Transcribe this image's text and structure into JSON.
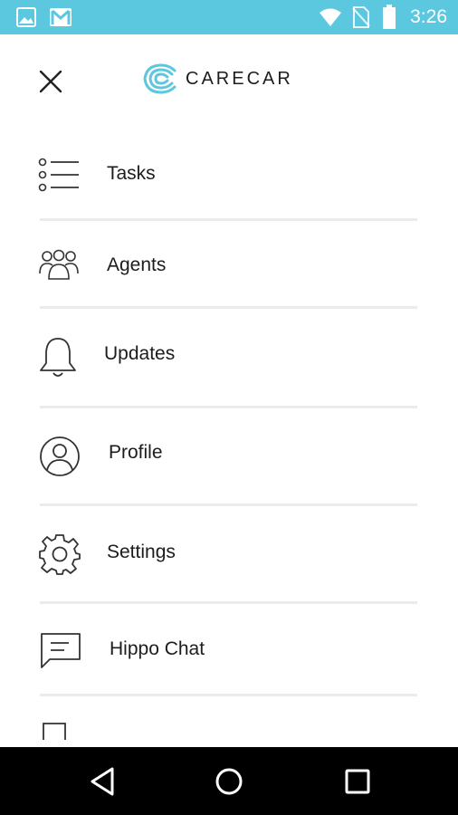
{
  "status_bar": {
    "time": "3:26",
    "icons": [
      "image-icon",
      "gmail-icon",
      "wifi-icon",
      "no-sim-icon",
      "battery-icon"
    ],
    "background": "#5cc8e0"
  },
  "header": {
    "close_icon": "close-icon",
    "logo_text": "CARECAR",
    "logo_color": "#5cc8e0"
  },
  "menu": {
    "items": [
      {
        "label": "Tasks",
        "icon": "list-icon"
      },
      {
        "label": "Agents",
        "icon": "agents-icon"
      },
      {
        "label": "Updates",
        "icon": "bell-icon"
      },
      {
        "label": "Profile",
        "icon": "profile-icon"
      },
      {
        "label": "Settings",
        "icon": "gear-icon"
      },
      {
        "label": "Hippo Chat",
        "icon": "chat-icon"
      }
    ]
  },
  "nav_bar": {
    "buttons": [
      "back-icon",
      "home-icon",
      "recents-icon"
    ]
  }
}
